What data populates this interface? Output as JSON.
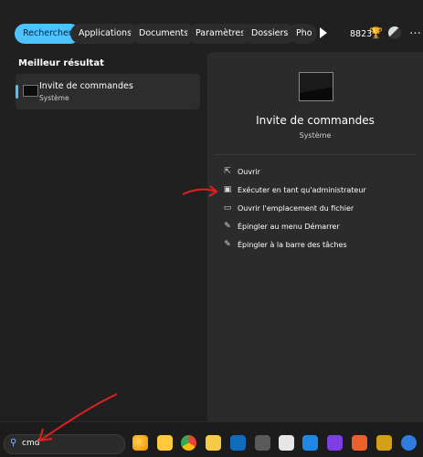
{
  "filters": {
    "tabs": [
      {
        "label": "Rechercher",
        "active": true
      },
      {
        "label": "Applications"
      },
      {
        "label": "Documents"
      },
      {
        "label": "Paramètres"
      },
      {
        "label": "Dossiers"
      },
      {
        "label": "Pho"
      }
    ],
    "points": "8823"
  },
  "results": {
    "section_title": "Meilleur résultat",
    "best": {
      "name": "Invite de commandes",
      "type": "Système"
    }
  },
  "detail": {
    "title": "Invite de commandes",
    "subtitle": "Système",
    "actions": [
      {
        "label": "Ouvrir",
        "icon": "open-external-icon"
      },
      {
        "label": "Exécuter en tant qu'administrateur",
        "icon": "shield-admin-icon"
      },
      {
        "label": "Ouvrir l'emplacement du fichier",
        "icon": "folder-icon"
      },
      {
        "label": "Épingler au menu Démarrer",
        "icon": "pin-icon"
      },
      {
        "label": "Épingler à la barre des tâches",
        "icon": "pin-icon"
      }
    ]
  },
  "taskbar": {
    "search_value": "cmd",
    "apps": [
      "edge-icon",
      "file-explorer-icon",
      "chrome-icon",
      "folder-icon",
      "outlook-icon",
      "calculator-icon",
      "app-icon",
      "app-icon",
      "affinity-icon",
      "app-icon",
      "app-icon",
      "app-icon",
      "app-icon"
    ]
  },
  "colors": {
    "accent": "#4cc2ff",
    "annotation": "#e02020"
  }
}
